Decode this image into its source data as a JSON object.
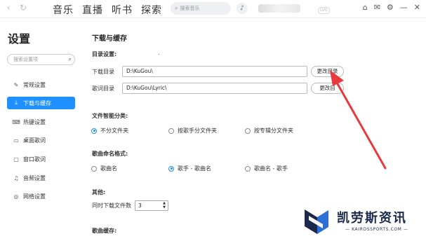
{
  "topbar": {
    "back_glyph": "‹",
    "refresh_glyph": "↻",
    "nav": [
      "音乐",
      "直播",
      "听书",
      "探索"
    ],
    "search_placeholder": "搜索音乐",
    "mic_glyph": "♪",
    "vip_label": "LV0",
    "icons": [
      "shirt-icon",
      "mail-icon",
      "settings-icon",
      "minimize-icon",
      "close-icon"
    ],
    "icon_glyphs": [
      "⌂",
      "✉",
      "⚙",
      "—",
      "✕"
    ]
  },
  "sidebar": {
    "title": "设置",
    "search_placeholder": "搜索设置项",
    "items": [
      {
        "label": "常规设置",
        "icon": "wrench-icon",
        "glyph": "🔧",
        "active": false
      },
      {
        "label": "下载与缓存",
        "icon": "download-icon",
        "glyph": "⤓",
        "active": true
      },
      {
        "label": "热键设置",
        "icon": "keyboard-icon",
        "glyph": "⌨",
        "active": false
      },
      {
        "label": "桌面歌词",
        "icon": "monitor-icon",
        "glyph": "▭",
        "active": false
      },
      {
        "label": "窗口歌词",
        "icon": "window-icon",
        "glyph": "▢",
        "active": false
      },
      {
        "label": "音频设置",
        "icon": "audio-icon",
        "glyph": "♫",
        "active": false
      },
      {
        "label": "网络设置",
        "icon": "network-icon",
        "glyph": "◎",
        "active": false
      }
    ]
  },
  "main": {
    "title": "下载与缓存",
    "dir_section": "目录设置:",
    "dir_dot": ".",
    "download_dir_label": "下载目录",
    "download_dir_value": "D:\\KuGou\\",
    "lyric_dir_label": "歌词目录",
    "lyric_dir_value": "D:\\KuGou\\Lyric\\",
    "change_dir_btn": "更改目录",
    "change_dir_btn2": "更改目",
    "classify_section": "文件智能分类:",
    "classify_options": [
      "不分文件夹",
      "按歌手分文件夹",
      "按专辑分文件夹"
    ],
    "classify_selected": 0,
    "naming_section": "歌曲命名格式:",
    "naming_options": [
      "歌曲名",
      "歌手 - 歌曲名",
      "歌曲名 - 歌手"
    ],
    "naming_selected": 1,
    "other_section": "其他:",
    "concurrent_label": "同时下载文件数",
    "concurrent_value": "3",
    "cache_section": "歌曲缓存:"
  },
  "watermark": {
    "title": "凯劳斯资讯",
    "subtitle": "— KAIROSSPORTS.COM —"
  },
  "colors": {
    "accent": "#1e90ff",
    "arrow": "#e8393f"
  }
}
